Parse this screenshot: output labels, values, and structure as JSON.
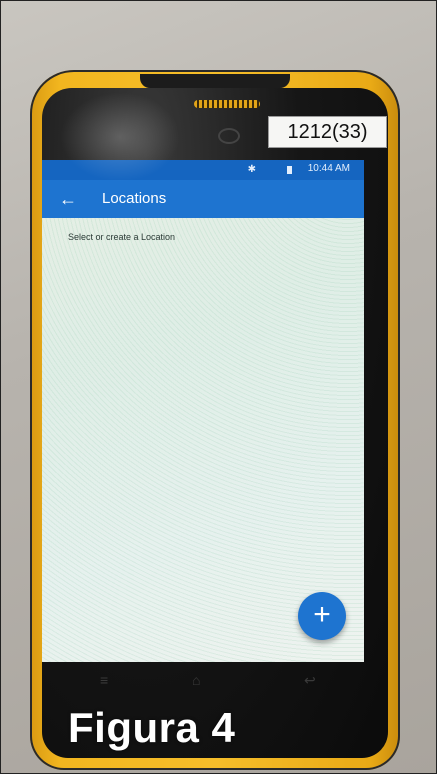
{
  "photo": {
    "label_sticker": "1212(33)",
    "caption": "Figura 4"
  },
  "device": {
    "body_color": "#f3b923",
    "status_bar": {
      "time": "10:44 AM",
      "color": "#1565c0",
      "icons": [
        "bluetooth-icon",
        "battery-icon"
      ]
    },
    "app_bar": {
      "title": "Locations",
      "back_icon": "back-arrow-icon",
      "color": "#1e74d0"
    },
    "content": {
      "hint": "Select or create a Location"
    },
    "fab": {
      "icon": "plus-icon",
      "label": "+",
      "color": "#1e74d0"
    },
    "nav_keys": [
      "menu-key-icon",
      "home-key-icon",
      "back-key-icon"
    ]
  }
}
